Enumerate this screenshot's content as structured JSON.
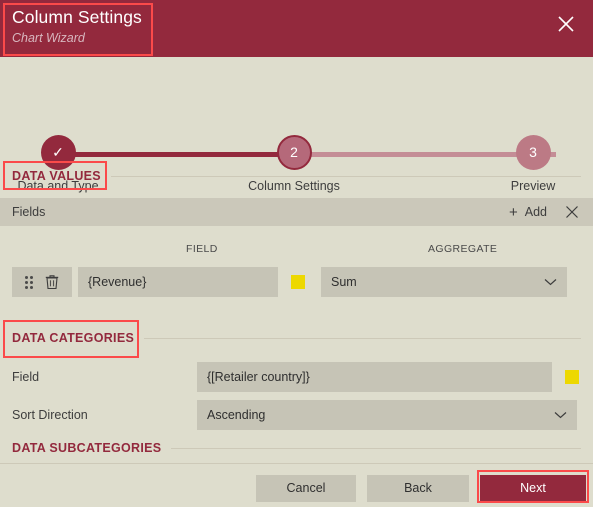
{
  "header": {
    "title": "Column Settings",
    "subtitle": "Chart Wizard",
    "close_icon": "close-icon"
  },
  "stepper": {
    "steps": [
      {
        "marker": "✓",
        "label": "Data and Type",
        "state": "done"
      },
      {
        "marker": "2",
        "label": "Column Settings",
        "state": "current"
      },
      {
        "marker": "3",
        "label": "Preview",
        "state": "todo"
      }
    ]
  },
  "sections": {
    "data_values": {
      "heading": "DATA VALUES",
      "toolbar": {
        "title": "Fields",
        "add_label": "Add",
        "add_icon": "plus-icon",
        "close_icon": "close-icon"
      },
      "columns": [
        "FIELD",
        "AGGREGATE"
      ],
      "rows": [
        {
          "drag_icon": "drag-handle-icon",
          "delete_icon": "trash-icon",
          "field_value": "{Revenue}",
          "color_swatch": "#EDD800",
          "aggregate_value": "Sum",
          "chevron_icon": "chevron-down-icon"
        }
      ]
    },
    "data_categories": {
      "heading": "DATA CATEGORIES",
      "field_label": "Field",
      "field_value": "{[Retailer country]}",
      "color_swatch": "#EDD800",
      "sort_label": "Sort Direction",
      "sort_value": "Ascending",
      "chevron_icon": "chevron-down-icon"
    },
    "data_subcategories": {
      "heading": "DATA SUBCATEGORIES"
    }
  },
  "footer": {
    "cancel_label": "Cancel",
    "back_label": "Back",
    "next_label": "Next"
  },
  "theme": {
    "accent": "#93293D",
    "accent_light": "#BC7A85",
    "background": "#DEDDCD",
    "control": "#C6C4B6",
    "annotation": "#FB4A4A"
  }
}
